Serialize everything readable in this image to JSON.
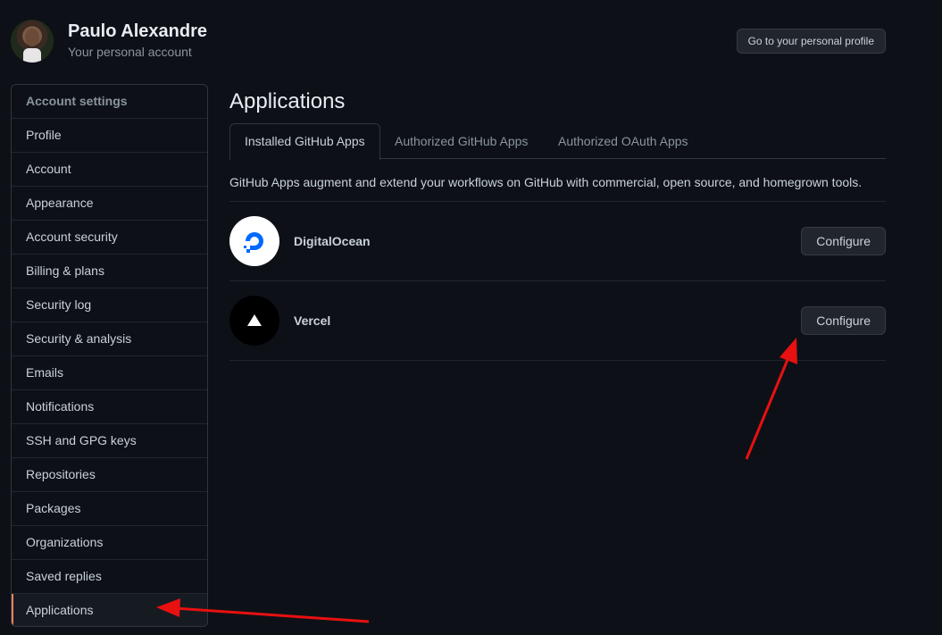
{
  "header": {
    "user_name": "Paulo Alexandre",
    "user_subtitle": "Your personal account",
    "profile_button": "Go to your personal profile"
  },
  "sidebar": {
    "heading": "Account settings",
    "items": [
      {
        "label": "Profile"
      },
      {
        "label": "Account"
      },
      {
        "label": "Appearance"
      },
      {
        "label": "Account security"
      },
      {
        "label": "Billing & plans"
      },
      {
        "label": "Security log"
      },
      {
        "label": "Security & analysis"
      },
      {
        "label": "Emails"
      },
      {
        "label": "Notifications"
      },
      {
        "label": "SSH and GPG keys"
      },
      {
        "label": "Repositories"
      },
      {
        "label": "Packages"
      },
      {
        "label": "Organizations"
      },
      {
        "label": "Saved replies"
      },
      {
        "label": "Applications",
        "active": true
      }
    ]
  },
  "main": {
    "title": "Applications",
    "tabs": [
      {
        "label": "Installed GitHub Apps",
        "selected": true
      },
      {
        "label": "Authorized GitHub Apps"
      },
      {
        "label": "Authorized OAuth Apps"
      }
    ],
    "description": "GitHub Apps augment and extend your workflows on GitHub with commercial, open source, and homegrown tools.",
    "apps": [
      {
        "name": "DigitalOcean",
        "button": "Configure",
        "logo": "digitalocean-logo"
      },
      {
        "name": "Vercel",
        "button": "Configure",
        "logo": "vercel-logo"
      }
    ]
  },
  "colors": {
    "background": "#0d1117",
    "active_indicator": "#f78166",
    "annotation_arrow": "#e81010",
    "digitalocean_blue": "#0069ff"
  }
}
